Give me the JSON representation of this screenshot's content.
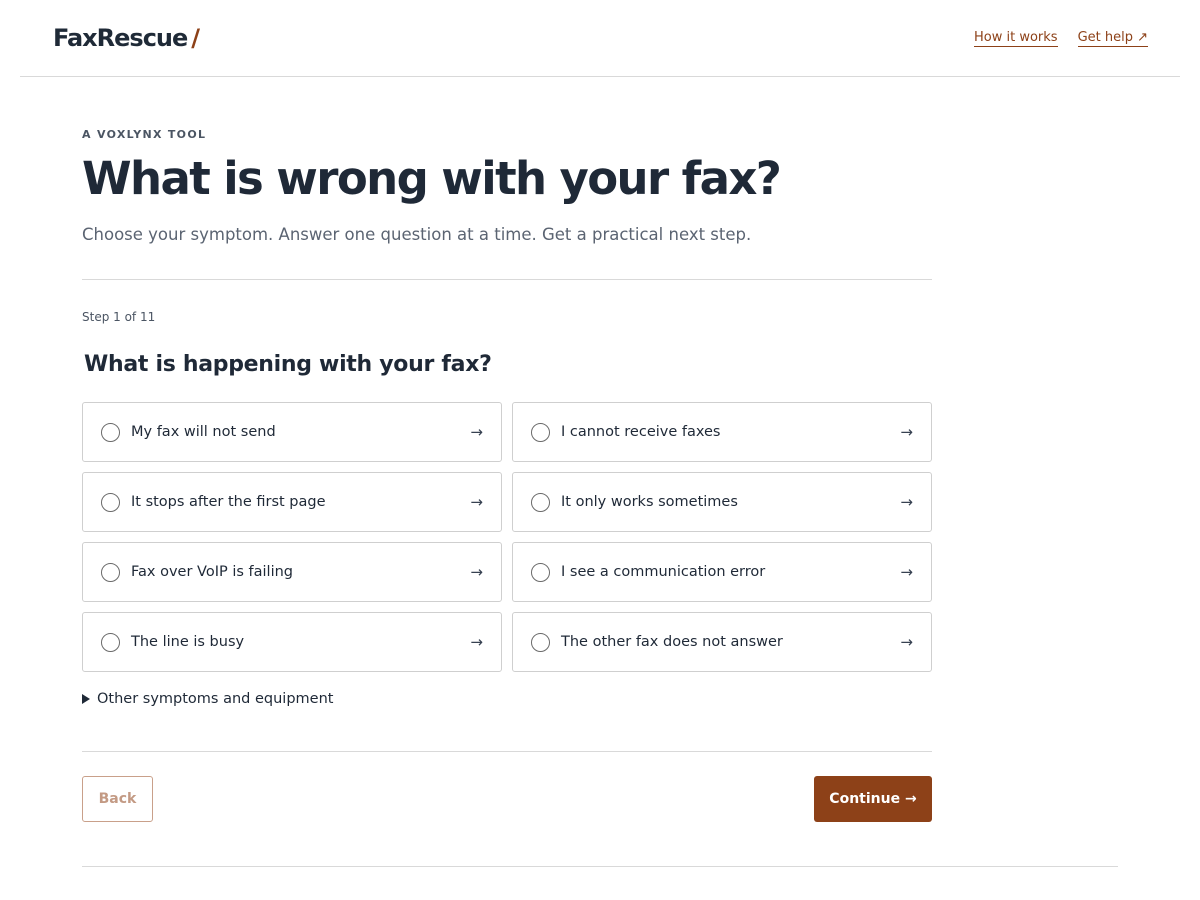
{
  "header": {
    "brand": "FaxRescue",
    "brand_slash": "/",
    "nav": {
      "how_it_works": "How it works",
      "get_help": "Get help ↗"
    }
  },
  "intro": {
    "eyebrow": "A VOXLYNX TOOL",
    "title": "What is wrong with your fax?",
    "subtitle": "Choose your symptom. Answer one question at a time. Get a practical next step."
  },
  "wizard": {
    "step": "Step 1 of 11",
    "question": "What is happening with your fax?",
    "arrow_glyph": "→",
    "options": [
      {
        "label": "My fax will not send"
      },
      {
        "label": "I cannot receive faxes"
      },
      {
        "label": "It stops after the first page"
      },
      {
        "label": "It only works sometimes"
      },
      {
        "label": "Fax over VoIP is failing"
      },
      {
        "label": "I see a communication error"
      },
      {
        "label": "The line is busy"
      },
      {
        "label": "The other fax does not answer"
      }
    ],
    "more_label": "Other symptoms and equipment",
    "back_label": "Back",
    "continue_label": "Continue →"
  },
  "colors": {
    "accent": "#8d4118",
    "text": "#1f2937",
    "muted": "#5b6472",
    "border": "#cfcfcf"
  }
}
